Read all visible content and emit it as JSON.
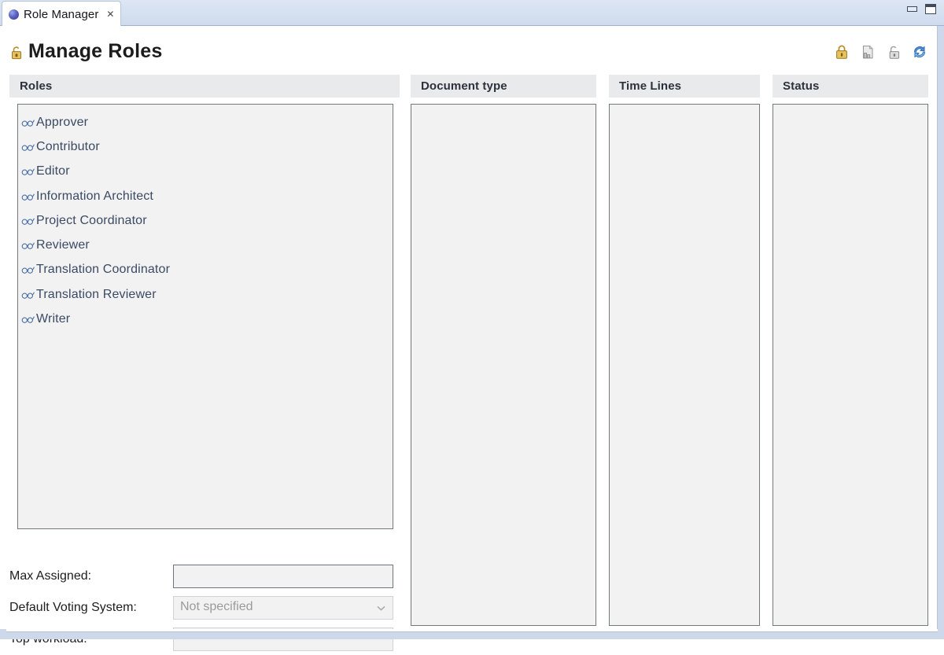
{
  "window": {
    "tab": {
      "title": "Role Manager",
      "icon": "sphere-icon",
      "close_glyph": "✕"
    },
    "controls": {
      "minimize_label": "Minimize",
      "maximize_label": "Maximize"
    }
  },
  "header": {
    "title": "Manage Roles",
    "icon": "open-padlock-icon",
    "toolbar": [
      {
        "name": "lock-icon",
        "tooltip": "Lock"
      },
      {
        "name": "copy-document-icon",
        "tooltip": "Copy"
      },
      {
        "name": "unlock-icon",
        "tooltip": "Unlock"
      },
      {
        "name": "refresh-icon",
        "tooltip": "Refresh"
      }
    ]
  },
  "columns": [
    {
      "key": "roles",
      "header": "Roles",
      "items": [
        {
          "icon": "glasses-icon",
          "label": "Approver"
        },
        {
          "icon": "glasses-icon",
          "label": "Contributor"
        },
        {
          "icon": "glasses-icon",
          "label": "Editor"
        },
        {
          "icon": "glasses-icon",
          "label": "Information Architect"
        },
        {
          "icon": "glasses-icon",
          "label": "Project Coordinator"
        },
        {
          "icon": "glasses-icon",
          "label": "Reviewer"
        },
        {
          "icon": "glasses-icon",
          "label": "Translation Coordinator"
        },
        {
          "icon": "glasses-icon",
          "label": "Translation Reviewer"
        },
        {
          "icon": "glasses-icon",
          "label": "Writer"
        }
      ]
    },
    {
      "key": "document_type",
      "header": "Document type",
      "items": []
    },
    {
      "key": "time_lines",
      "header": "Time Lines",
      "items": []
    },
    {
      "key": "status",
      "header": "Status",
      "items": []
    }
  ],
  "fields": {
    "max_assigned": {
      "label": "Max Assigned:",
      "value": "",
      "placeholder": ""
    },
    "default_voting_system": {
      "label": "Default Voting System:",
      "value": "Not specified",
      "arrow_icon": "chevron-down-icon"
    },
    "top_workload": {
      "label": "Top workload:",
      "value": "",
      "placeholder": ""
    }
  },
  "colors": {
    "tab_bar": "#cfdcee",
    "header_band": "#e9eaec",
    "list_background": "#f2f2f2",
    "list_border": "#707880",
    "role_text": "#3b4a63",
    "lock_gold": "#d8a93a",
    "refresh_blue": "#2f6cb5"
  }
}
